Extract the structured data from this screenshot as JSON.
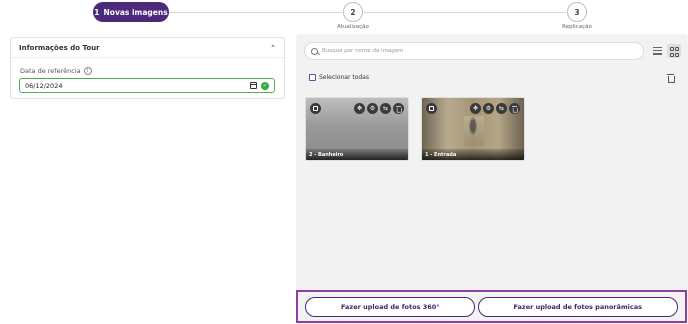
{
  "stepper": {
    "steps": [
      {
        "number": "1",
        "label": "Novas imagens",
        "active": true
      },
      {
        "number": "2",
        "label": "Atualização",
        "active": false
      },
      {
        "number": "3",
        "label": "Replicação",
        "active": false
      }
    ]
  },
  "tour_panel": {
    "title": "Informações do Tour",
    "date_label": "Data de referência",
    "date_value": "06/12/2024"
  },
  "images_panel": {
    "search_placeholder": "Busque por nome da imagem",
    "select_all_label": "Selecionar todas",
    "cards": [
      {
        "caption": "2 - Banheiro"
      },
      {
        "caption": "1 - Entrada"
      }
    ]
  },
  "upload": {
    "btn_360": "Fazer upload de fotos 360°",
    "btn_panoramic": "Fazer upload de fotos panorâmicas"
  },
  "colors": {
    "accent": "#4b2a7b",
    "highlight_border": "#8e3fa0",
    "success": "#3aa845"
  }
}
